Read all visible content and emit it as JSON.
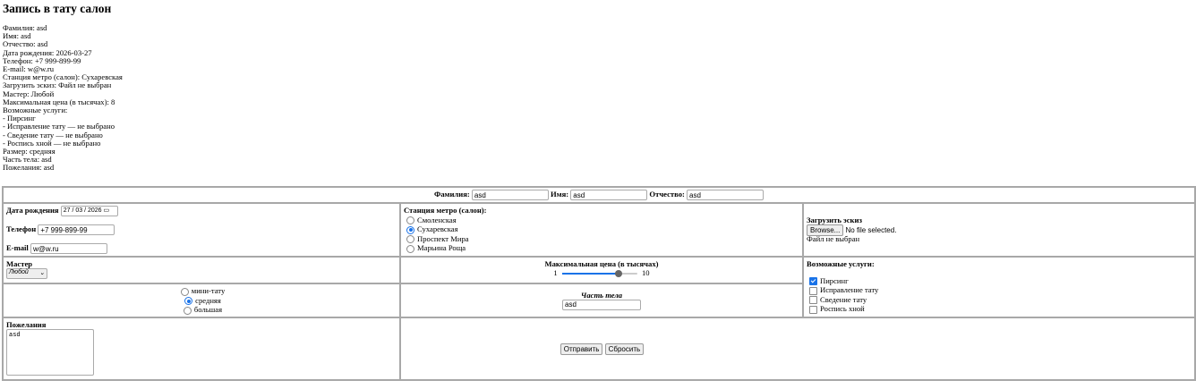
{
  "title": "Запись в тату салон",
  "summary": [
    "Фамилия: asd",
    "Имя: asd",
    "Отчество: asd",
    "Дата рождения: 2026-03-27",
    "Телефон: +7 999-899-99",
    "E-mail: w@w.ru",
    "Станция метро (салон): Сухаревская",
    "Загрузить эскиз: Файл не выбран",
    "Мастер: Любой",
    "Максимальная цена (в тысячах): 8",
    "Возможные услуги:",
    "- Пирсинг",
    "- Исправление тату — не выбрано",
    "- Сведение тату — не выбрано",
    "- Роспись хной — не выбрано",
    "Размер: средняя",
    "Часть тела: asd",
    "Пожелания: asd"
  ],
  "form": {
    "surname_label": "Фамилия:",
    "surname": "asd",
    "name_label": "Имя:",
    "name": "asd",
    "patronymic_label": "Отчество:",
    "patronymic": "asd",
    "birth_label": "Дата рождения",
    "birth": "27 / 03 / 2026",
    "phone_label": "Телефон",
    "phone": "+7 999-899-99",
    "email_label": "E-mail",
    "email": "w@w.ru",
    "metro_label": "Станция метро (салон):",
    "metro": [
      {
        "label": "Смоленская",
        "checked": false
      },
      {
        "label": "Сухаревская",
        "checked": true
      },
      {
        "label": "Проспект Мира",
        "checked": false
      },
      {
        "label": "Марьина Роща",
        "checked": false
      }
    ],
    "upload_label": "Загрузить эскиз",
    "browse": "Browse...",
    "no_file": "No file selected.",
    "file_status": "Файл не выбран",
    "master_label": "Мастер",
    "master": "Любой",
    "price_label": "Максимальная цена (в тысячах)",
    "price_min": "1",
    "price_max": "10",
    "price_value": 8,
    "services_label": "Возможные услуги:",
    "services": [
      {
        "label": "Пирсинг",
        "checked": true
      },
      {
        "label": "Исправление тату",
        "checked": false
      },
      {
        "label": "Сведение тату",
        "checked": false
      },
      {
        "label": "Роспись хной",
        "checked": false
      }
    ],
    "sizes": [
      {
        "label": "мини-тату",
        "checked": false
      },
      {
        "label": "средняя",
        "checked": true
      },
      {
        "label": "большая",
        "checked": false
      }
    ],
    "body_part_label": "Часть тела",
    "body_part": "asd",
    "wishes_label": "Пожелания",
    "wishes": "asd",
    "submit": "Отправить",
    "reset": "Сбросить"
  }
}
